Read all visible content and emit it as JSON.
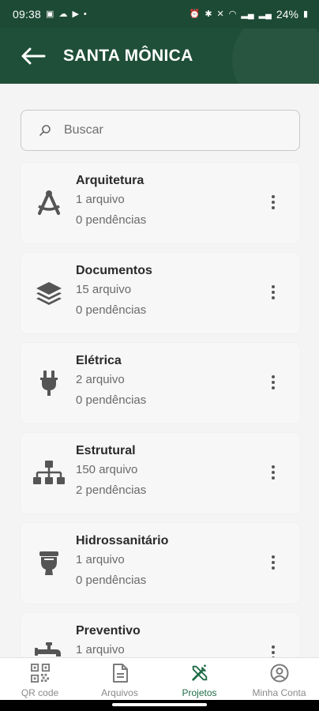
{
  "status_bar": {
    "time": "09:38",
    "battery": "24%"
  },
  "header": {
    "title": "SANTA MÔNICA"
  },
  "search": {
    "placeholder": "Buscar"
  },
  "items": [
    {
      "title": "Arquitetura",
      "files": "1 arquivo",
      "pending": "0 pendências",
      "icon": "drafting-compass-icon"
    },
    {
      "title": "Documentos",
      "files": "15 arquivo",
      "pending": "0 pendências",
      "icon": "layers-icon"
    },
    {
      "title": "Elétrica",
      "files": "2 arquivo",
      "pending": "0 pendências",
      "icon": "plug-icon"
    },
    {
      "title": "Estrutural",
      "files": "150 arquivo",
      "pending": "2 pendências",
      "icon": "sitemap-icon"
    },
    {
      "title": "Hidrossanitário",
      "files": "1 arquivo",
      "pending": "0 pendências",
      "icon": "toilet-icon"
    },
    {
      "title": "Preventivo",
      "files": "1 arquivo",
      "pending": "",
      "icon": "faucet-icon"
    }
  ],
  "bottom_nav": [
    {
      "label": "QR code",
      "icon": "qr-code-icon"
    },
    {
      "label": "Arquivos",
      "icon": "file-icon"
    },
    {
      "label": "Projetos",
      "icon": "tools-icon",
      "active": true
    },
    {
      "label": "Minha Conta",
      "icon": "user-circle-icon"
    }
  ],
  "colors": {
    "header_bg": "#1f4f38",
    "accent": "#1f6b46",
    "icon_gray": "#555555"
  }
}
